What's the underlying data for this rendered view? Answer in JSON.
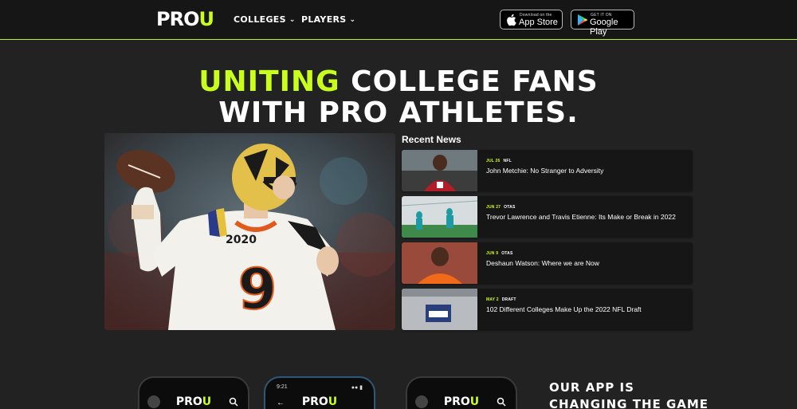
{
  "header": {
    "logo_main": "PRO",
    "logo_accent": "U",
    "nav": [
      {
        "label": "COLLEGES"
      },
      {
        "label": "PLAYERS"
      }
    ],
    "app_store": {
      "small": "Download on the",
      "big": "App Store"
    },
    "google_play": {
      "small": "GET IT ON",
      "big": "Google Play"
    }
  },
  "hero": {
    "line1_accent": "UNITING",
    "line1_rest": " COLLEGE FANS",
    "line2": "WITH PRO ATHLETES."
  },
  "recent_news": {
    "heading": "Recent News",
    "items": [
      {
        "date": "JUL 26",
        "category": "NFL",
        "title": "John Metchie: No Stranger to Adversity"
      },
      {
        "date": "JUN 27",
        "category": "OTAS",
        "title": "Trevor Lawrence and Travis Etienne: Its Make or Break in 2022"
      },
      {
        "date": "JUN 9",
        "category": "OTAS",
        "title": "Deshaun Watson: Where we are Now"
      },
      {
        "date": "MAY 2",
        "category": "DRAFT",
        "title": "102 Different Colleges Make Up the 2022 NFL Draft"
      }
    ]
  },
  "phones": {
    "logo_main": "PRO",
    "logo_accent": "U",
    "time": "9:21"
  },
  "app_promo": {
    "line1": "OUR APP IS",
    "line2": "CHANGING THE GAME"
  },
  "colors": {
    "accent": "#c9ff1c",
    "background": "#222222",
    "header": "#161616",
    "card": "#161616"
  }
}
